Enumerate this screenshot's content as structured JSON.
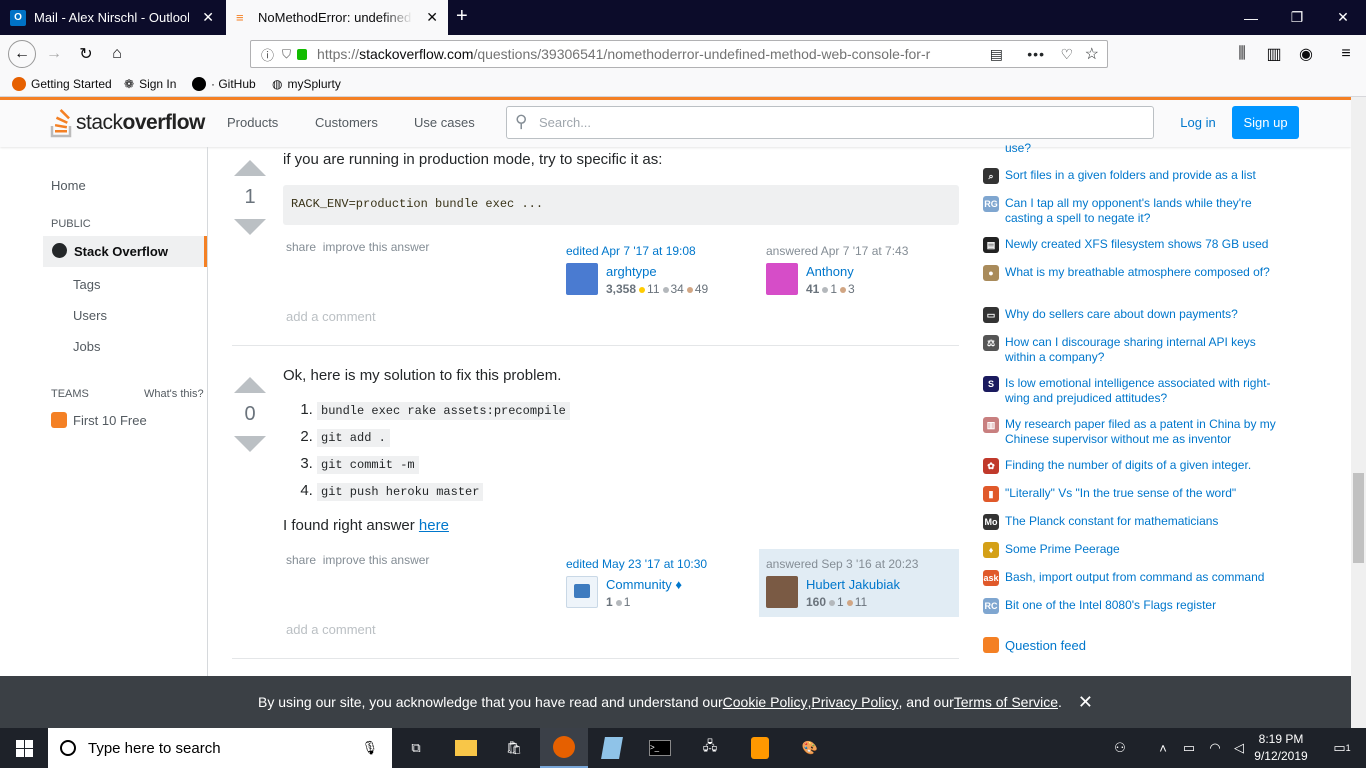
{
  "browser": {
    "tabs": [
      {
        "title": "Mail - Alex Nirschl - Outlook"
      },
      {
        "title": "NoMethodError: undefined method"
      }
    ],
    "url_prefix": "https://",
    "url_domain": "stackoverflow.com",
    "url_path": "/questions/39306541/nomethoderror-undefined-method-web-console-for-r",
    "bookmarks": [
      {
        "label": "Getting Started"
      },
      {
        "label": "Sign In"
      },
      {
        "label": "· GitHub"
      },
      {
        "label": "mySplurty"
      }
    ]
  },
  "header": {
    "logo_a": "stack",
    "logo_b": "overflow",
    "nav": [
      "Products",
      "Customers",
      "Use cases"
    ],
    "search_placeholder": "Search...",
    "login": "Log in",
    "signup": "Sign up"
  },
  "sidebar": {
    "home": "Home",
    "public": "PUBLIC",
    "so": "Stack Overflow",
    "tags": "Tags",
    "users": "Users",
    "jobs": "Jobs",
    "teams": "TEAMS",
    "whats_this": "What's this?",
    "first10": "First 10 Free"
  },
  "answers": [
    {
      "votes": "1",
      "intro": "if you are running in production mode, try to specific it as:",
      "code": "RACK_ENV=production bundle exec ...",
      "share": "share",
      "improve": "improve this answer",
      "edited": "edited Apr 7 '17 at 19:08",
      "editor": {
        "name": "arghtype",
        "rep": "3,358",
        "gold": "11",
        "silver": "34",
        "bronze": "49"
      },
      "answered": "answered Apr 7 '17 at 7:43",
      "author": {
        "name": "Anthony",
        "rep": "41",
        "silver": "1",
        "bronze": "3"
      },
      "add_comment": "add a comment"
    },
    {
      "votes": "0",
      "intro": "Ok, here is my solution to fix this problem.",
      "steps": [
        "bundle exec rake assets:precompile",
        "git add .",
        "git commit -m",
        "git push heroku master"
      ],
      "found_prefix": "I found right answer ",
      "found_link": "here",
      "share": "share",
      "improve": "improve this answer",
      "edited": "edited May 23 '17 at 10:30",
      "editor": {
        "name": "Community ♦",
        "rep": "1",
        "silver": "1"
      },
      "answered": "answered Sep 3 '16 at 20:23",
      "author": {
        "name": "Hubert Jakubiak",
        "rep": "160",
        "silver": "1",
        "bronze": "11"
      },
      "add_comment": "add a comment"
    }
  ],
  "hot_questions": [
    {
      "text": "use?",
      "icon_color": "#888"
    },
    {
      "text": "Sort files in a given folders and provide as a list",
      "icon_color": "#333"
    },
    {
      "text": "Can I tap all my opponent's lands while they're casting a spell to negate it?",
      "icon_color": "#7fa6d0"
    },
    {
      "text": "Newly created XFS filesystem shows 78 GB used",
      "icon_color": "#222"
    },
    {
      "text": "What is my breathable atmosphere composed of?",
      "icon_color": "#a98b5b"
    },
    {
      "text": "Why do sellers care about down payments?",
      "icon_color": "#333"
    },
    {
      "text": "How can I discourage sharing internal API keys within a company?",
      "icon_color": "#555"
    },
    {
      "text": "Is low emotional intelligence associated with right-wing and prejudiced attitudes?",
      "icon_color": "#1a1a5e"
    },
    {
      "text": "My research paper filed as a patent in China by my Chinese supervisor without me as inventor",
      "icon_color": "#c87f7f"
    },
    {
      "text": "Finding the number of digits of a given integer.",
      "icon_color": "#c0392b"
    },
    {
      "text": "\"Literally\" Vs \"In the true sense of the word\"",
      "icon_color": "#e0592a"
    },
    {
      "text": "The Planck constant for mathematicians",
      "icon_color": "#333"
    },
    {
      "text": "Some Prime Peerage",
      "icon_color": "#d4a017"
    },
    {
      "text": "Bash, import output from command as command",
      "icon_color": "#e0592a"
    },
    {
      "text": "Bit one of the Intel 8080's Flags register",
      "icon_color": "#7fa6d0"
    }
  ],
  "question_feed": "Question feed",
  "cookie": {
    "prefix": "By using our site, you acknowledge that you have read and understand our ",
    "cookie_policy": "Cookie Policy",
    "sep1": ", ",
    "privacy_policy": "Privacy Policy",
    "sep2": ", and our ",
    "terms": "Terms of Service",
    "suffix": "."
  },
  "taskbar": {
    "search": "Type here to search",
    "time": "8:19 PM",
    "date": "9/12/2019",
    "notif": "1"
  }
}
